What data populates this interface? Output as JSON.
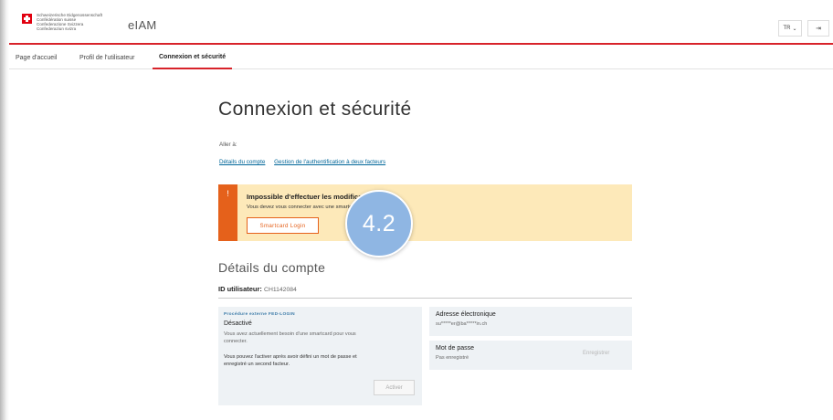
{
  "header": {
    "confederation_lines": [
      "Schweizerische Eidgenossenschaft",
      "Confédération suisse",
      "Confederazione Svizzera",
      "Confederaziun svizra"
    ],
    "app_title": "eIAM",
    "language": "TR",
    "language_chevron": "⌄",
    "logout_icon": "⇥"
  },
  "nav": {
    "items": [
      {
        "label": "Page d'accueil"
      },
      {
        "label": "Profil de l'utilisateur"
      },
      {
        "label": "Connexion et sécurité"
      }
    ]
  },
  "main": {
    "title": "Connexion et sécurité",
    "goto_label": "Aller à:",
    "goto_links": [
      "Détails du compte",
      "Gestion de l'authentification à deux facteurs"
    ]
  },
  "alert": {
    "icon": "!",
    "title": "Impossible d'effectuer les modifications!",
    "text": "Vous devez vous connecter avec une smartcard.",
    "button_label": "Smartcard Login"
  },
  "account": {
    "section_title": "Détails du compte",
    "user_id_label": "ID utilisateur:",
    "user_id_value": "CH1142084"
  },
  "cards": {
    "fed_login": {
      "small_label": "Procédure externe FED-LOGIN",
      "status": "Désactivé",
      "text1": "Vous avez actuellement besoin d'une smartcard pour vous connecter.",
      "text2": "Vous pouvez l'activer après avoir défini un mot de passe et enregistré un second facteur.",
      "button_label": "Activer"
    },
    "email": {
      "label": "Adresse électronique",
      "value": "su*****er@ba*****in.ch"
    },
    "password": {
      "label": "Mot de passe",
      "value": "Pas enregistré",
      "action_label": "Enregistrer"
    }
  },
  "step_badge": "4.2",
  "colors": {
    "swiss_red": "#d8232a",
    "alert_bg": "#fde9b9",
    "alert_accent": "#e5611b",
    "link": "#006699",
    "badge": "#8fb6e3",
    "card_bg": "#eef2f5"
  }
}
